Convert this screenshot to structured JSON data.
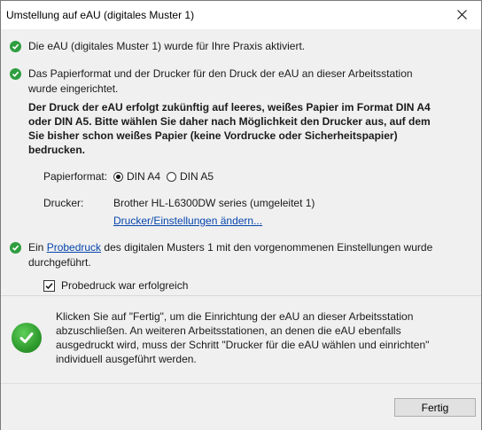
{
  "window": {
    "title": "Umstellung auf eAU (digitales Muster 1)",
    "close_symbol": "✕"
  },
  "messages": {
    "activated": "Die eAU (digitales Muster 1) wurde für Ihre Praxis aktiviert.",
    "printer_setup_line1": "Das Papierformat und der Drucker für den Druck der eAU an dieser Arbeitsstation",
    "printer_setup_line2": "wurde eingerichtet.",
    "notice_line1": "Der Druck der eAU erfolgt zukünftig auf leeres, weißes Papier im Format DIN A4",
    "notice_line2": "oder DIN A5. Bitte wählen Sie daher nach Möglichkeit den Drucker aus, auf dem",
    "notice_line3": "Sie bisher schon weißes Papier (keine Vordrucke oder Sicherheitspapier)",
    "notice_line4": "bedrucken."
  },
  "paper_format": {
    "label": "Papierformat:",
    "options": [
      "DIN A4",
      "DIN A5"
    ],
    "selected": "DIN A4"
  },
  "printer": {
    "label": "Drucker:",
    "value": "Brother HL-L6300DW series (umgeleitet 1)",
    "change_link": "Drucker/Einstellungen ändern..."
  },
  "test_print": {
    "prefix": "Ein ",
    "link": "Probedruck",
    "suffix": " des digitalen Musters 1 mit den vorgenommenen Einstellungen wurde",
    "line2": "durchgeführt.",
    "checkbox_label": "Probedruck war erfolgreich",
    "checked": true
  },
  "finish_info": {
    "line1": "Klicken Sie auf \"Fertig\", um die Einrichtung der eAU an dieser Arbeitsstation",
    "line2": "abzuschließen. An weiteren Arbeitsstationen, an denen die eAU ebenfalls",
    "line3": "ausgedruckt wird, muss der Schritt \"Drucker für die eAU wählen und einrichten\"",
    "line4": "individuell ausgeführt werden."
  },
  "buttons": {
    "finish": "Fertig"
  },
  "colors": {
    "accent_green": "#2e9e3f",
    "link_blue": "#0645ad"
  }
}
